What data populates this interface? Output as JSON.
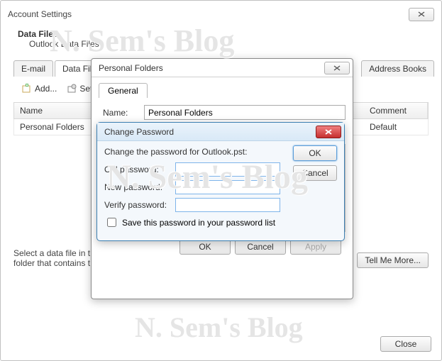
{
  "outer": {
    "title": "Account Settings",
    "group_title": "Data Files",
    "group_sub": "Outlook Data Files",
    "tabs": [
      "E-mail",
      "Data Files",
      "Address Books"
    ],
    "active_tab": 1,
    "toolbar": {
      "add": "Add...",
      "settings": "Settings"
    },
    "table": {
      "headers": {
        "name": "Name",
        "comment": "Comment"
      },
      "row": {
        "name": "Personal Folders",
        "comment": "Default"
      }
    },
    "note": "Select a data file in the list, then click Settings for more details or click Open Folder to display the folder that contains the data file.",
    "note_short": "Select a data file in the list...\nfolder that contains t",
    "tell_more": "Tell Me More...",
    "close": "Close"
  },
  "pf": {
    "title": "Personal Folders",
    "tab": "General",
    "name_label": "Name:",
    "name_value": "Personal Folders",
    "ok": "OK",
    "cancel": "Cancel",
    "apply": "Apply"
  },
  "cp": {
    "title": "Change Password",
    "msg": "Change the password for Outlook.pst:",
    "old": "Old password:",
    "new": "New password:",
    "verify": "Verify password:",
    "save_chk": "Save this password in your password list",
    "ok": "OK",
    "cancel": "Cancel"
  },
  "watermark": "N. Sem's Blog"
}
